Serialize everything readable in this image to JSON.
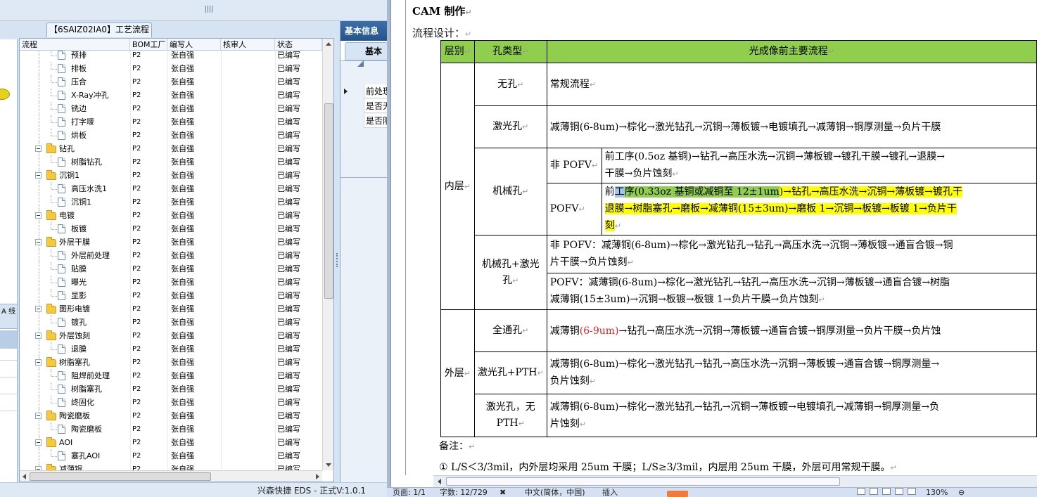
{
  "left_app": {
    "panel_tab": "【6SAIZ02IA0】工艺流程",
    "edge_vtext": "A\n线",
    "columns": [
      "流程",
      "BOM工厂",
      "编写人",
      "核审人",
      "状态"
    ],
    "rows": [
      {
        "name": "预排",
        "level": 2,
        "type": "file",
        "bom": "P2",
        "author": "张自强",
        "status": "已编写"
      },
      {
        "name": "排板",
        "level": 2,
        "type": "file",
        "bom": "P2",
        "author": "张自强",
        "status": "已编写"
      },
      {
        "name": "压合",
        "level": 2,
        "type": "file",
        "bom": "P2",
        "author": "张自强",
        "status": "已编写"
      },
      {
        "name": "X-Ray冲孔",
        "level": 2,
        "type": "file",
        "bom": "P2",
        "author": "张自强",
        "status": "已编写"
      },
      {
        "name": "铣边",
        "level": 2,
        "type": "file",
        "bom": "P2",
        "author": "张自强",
        "status": "已编写"
      },
      {
        "name": "打字嘜",
        "level": 2,
        "type": "file",
        "bom": "P2",
        "author": "张自强",
        "status": "已编写"
      },
      {
        "name": "烘板",
        "level": 2,
        "type": "file",
        "bom": "P2",
        "author": "张自强",
        "status": "已编写"
      },
      {
        "name": "钻孔",
        "level": 1,
        "type": "folder",
        "bom": "P2",
        "author": "张自强",
        "status": "已编写"
      },
      {
        "name": "树脂钻孔",
        "level": 2,
        "type": "file",
        "bom": "P2",
        "author": "张自强",
        "status": "已编写"
      },
      {
        "name": "沉铜1",
        "level": 1,
        "type": "folder",
        "bom": "P2",
        "author": "张自强",
        "status": "已编写"
      },
      {
        "name": "高压水洗1",
        "level": 2,
        "type": "file",
        "bom": "P2",
        "author": "张自强",
        "status": "已编写"
      },
      {
        "name": "沉铜1",
        "level": 2,
        "type": "file",
        "bom": "P2",
        "author": "张自强",
        "status": "已编写"
      },
      {
        "name": "电镀",
        "level": 1,
        "type": "folder",
        "bom": "P2",
        "author": "张自强",
        "status": "已编写"
      },
      {
        "name": "板镀",
        "level": 2,
        "type": "file",
        "bom": "P2",
        "author": "张自强",
        "status": "已编写"
      },
      {
        "name": "外层干膜",
        "level": 1,
        "type": "folder",
        "bom": "P2",
        "author": "张自强",
        "status": "已编写"
      },
      {
        "name": "外层前处理",
        "level": 2,
        "type": "file",
        "bom": "P2",
        "author": "张自强",
        "status": "已编写"
      },
      {
        "name": "贴膜",
        "level": 2,
        "type": "file",
        "bom": "P2",
        "author": "张自强",
        "status": "已编写"
      },
      {
        "name": "曝光",
        "level": 2,
        "type": "file",
        "bom": "P2",
        "author": "张自强",
        "status": "已编写"
      },
      {
        "name": "显影",
        "level": 2,
        "type": "file",
        "bom": "P2",
        "author": "张自强",
        "status": "已编写"
      },
      {
        "name": "图形电镀",
        "level": 1,
        "type": "folder",
        "bom": "P2",
        "author": "张自强",
        "status": "已编写"
      },
      {
        "name": "镀孔",
        "level": 2,
        "type": "file",
        "bom": "P2",
        "author": "张自强",
        "status": "已编写"
      },
      {
        "name": "外层蚀刻",
        "level": 1,
        "type": "folder",
        "bom": "P2",
        "author": "张自强",
        "status": "已编写"
      },
      {
        "name": "退膜",
        "level": 2,
        "type": "file",
        "bom": "P2",
        "author": "张自强",
        "status": "已编写"
      },
      {
        "name": "树脂塞孔",
        "level": 1,
        "type": "folder",
        "bom": "P2",
        "author": "张自强",
        "status": "已编写"
      },
      {
        "name": "阻焊前处理",
        "level": 2,
        "type": "file",
        "bom": "P2",
        "author": "张自强",
        "status": "已编写"
      },
      {
        "name": "树脂塞孔",
        "level": 2,
        "type": "file",
        "bom": "P2",
        "author": "张自强",
        "status": "已编写"
      },
      {
        "name": "终固化",
        "level": 2,
        "type": "file",
        "bom": "P2",
        "author": "张自强",
        "status": "已编写"
      },
      {
        "name": "陶瓷磨板",
        "level": 1,
        "type": "folder",
        "bom": "P2",
        "author": "张自强",
        "status": "已编写"
      },
      {
        "name": "陶瓷磨板",
        "level": 2,
        "type": "file",
        "bom": "P2",
        "author": "张自强",
        "status": "已编写"
      },
      {
        "name": "AOI",
        "level": 1,
        "type": "folder",
        "bom": "P2",
        "author": "张自强",
        "status": "已编写"
      },
      {
        "name": "塞孔AOI",
        "level": 2,
        "type": "file",
        "bom": "P2",
        "author": "张自强",
        "status": "已编写"
      },
      {
        "name": "减薄铜",
        "level": 1,
        "type": "folder",
        "bom": "P2",
        "author": "张自强",
        "status": "已编写"
      }
    ],
    "info_panel": {
      "title": "基本信息",
      "tab": "基本",
      "rows": [
        "前处理",
        "是否无",
        "是否阻"
      ]
    },
    "status_text": "兴森快捷 EDS - 正式V:1.0.1"
  },
  "document": {
    "heading": "CAM 制作",
    "subheading": "流程设计：",
    "table": {
      "headers": [
        "层别",
        "孔类型",
        "光成像前主要流程"
      ],
      "groups": {
        "inner": "内层",
        "outer": "外层"
      },
      "hole_types": {
        "none": "无孔",
        "laser": "激光孔",
        "mech": "机械孔",
        "mech_laser": "机械孔+激光孔",
        "through": "全通孔",
        "laser_pth": "激光孔+PTH",
        "laser_no_pth": "激光孔，无PTH"
      },
      "sub_types": {
        "non_pofv": "非 POFV",
        "pofv": "POFV"
      },
      "flows": {
        "none": "常规流程",
        "laser": "减薄铜(6-8um)→棕化→激光钻孔→沉铜→薄板镀→电镀填孔→减薄铜→铜厚测量→负片干膜",
        "mech_non_pofv_1": "前工序(0.5oz 基铜)→钻孔→高压水洗→沉铜→薄板镀→镀孔干膜→镀孔→退膜→",
        "mech_non_pofv_2": "干膜→负片蚀刻",
        "mech_pofv_1_a": "前",
        "mech_pofv_1_b": "工",
        "mech_pofv_1_c": "序(0.33oz 基铜或减铜至 12±1um",
        "mech_pofv_1_d": ")→钻孔→高压水洗→沉铜→薄板镀→镀孔干",
        "mech_pofv_2": "退膜→树脂塞孔→磨板→减薄铜(15±3um)→磨板 1→沉铜→板镀→板镀 1→负片干",
        "mech_pofv_3": "刻",
        "ml_non_pofv_1": "非 POFV：减薄铜(6-8um)→棕化→激光钻孔→钻孔→高压水洗→沉铜→薄板镀→通盲合镀→铜",
        "ml_non_pofv_2": "片干膜→负片蚀刻",
        "ml_pofv_1": "POFV：减薄铜(6-8um)→棕化→激光钻孔→钻孔→高压水洗→沉铜→薄板镀→通盲合镀→树脂",
        "ml_pofv_2": "减薄铜(15±3um)→沉铜→板镀→板镀 1→负片干膜→负片蚀刻",
        "through_a": "减薄铜",
        "through_b": "(6-9um)",
        "through_c": "→钻孔→高压水洗→沉铜→薄板镀→通盲合镀→铜厚测量→负片干膜→负片蚀",
        "laser_pth_1": "减薄铜(6-8um)→棕化→激光钻孔→钻孔→高压水洗→沉铜→薄板镀→通盲合镀→铜厚测量→",
        "laser_pth_2": "负片蚀刻",
        "laser_no_pth_1": "减薄铜(6-8um)→棕化→激光钻孔→钻孔→沉铜→薄板镀→电镀填孔→减薄铜→铜厚测量→负",
        "laser_no_pth_2": "片蚀刻"
      }
    },
    "note_label": "备注：",
    "note_text": "① L/S＜3/3mil，内外层均采用 25um 干膜；L/S≥3/3mil，内层用 25um 干膜，外层可用常规干膜。",
    "status_bar": {
      "page": "页面: 1/1",
      "words": "字数: 12/729",
      "language": "中文(简体，中国)",
      "mode": "插入",
      "zoom": "130%"
    }
  }
}
